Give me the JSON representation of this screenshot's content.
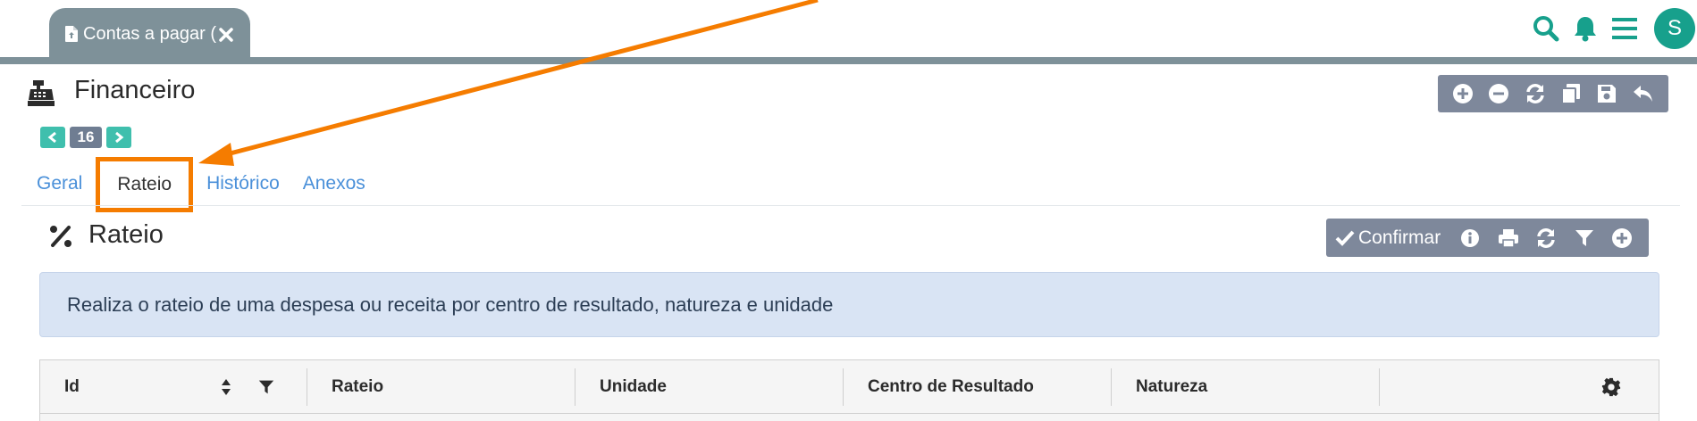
{
  "header": {
    "tab_label": "Contas a pagar (",
    "avatar_initial": "S",
    "icons": [
      "search-icon",
      "bell-icon",
      "menu-icon"
    ],
    "accent_color": "#17a08c"
  },
  "page": {
    "title": "Financeiro",
    "toolbar_icons": [
      "plus-circle-icon",
      "minus-circle-icon",
      "refresh-icon",
      "copy-icon",
      "save-icon",
      "undo-icon"
    ]
  },
  "pager": {
    "current": "16"
  },
  "tabs": [
    {
      "label": "Geral",
      "active": false
    },
    {
      "label": "Rateio",
      "active": true
    },
    {
      "label": "Histórico",
      "active": false
    },
    {
      "label": "Anexos",
      "active": false
    }
  ],
  "section": {
    "title": "Rateio",
    "confirm_label": "Confirmar",
    "toolbar_icons": [
      "info-icon",
      "print-icon",
      "refresh-icon",
      "filter-icon",
      "plus-circle-icon"
    ],
    "info_text": "Realiza o rateio de uma despesa ou receita por centro de resultado, natureza e unidade"
  },
  "table": {
    "columns": [
      "Id",
      "Rateio",
      "Unidade",
      "Centro de Resultado",
      "Natureza",
      ""
    ]
  },
  "annotation": {
    "color": "#f57c00"
  }
}
